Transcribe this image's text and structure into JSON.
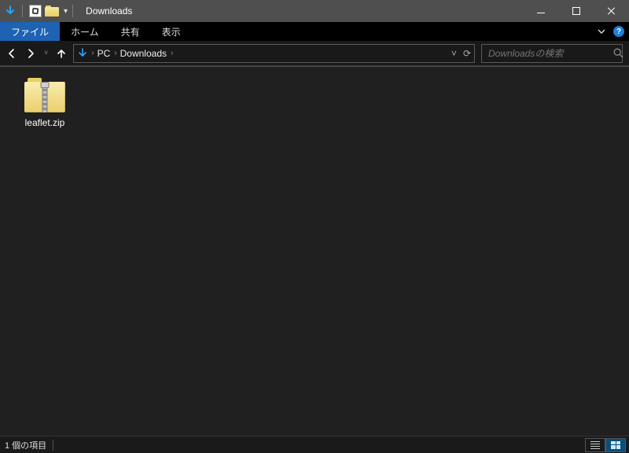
{
  "window": {
    "title": "Downloads"
  },
  "ribbon": {
    "file": "ファイル",
    "home": "ホーム",
    "share": "共有",
    "view": "表示"
  },
  "breadcrumb": {
    "root": "PC",
    "folder": "Downloads"
  },
  "search": {
    "placeholder": "Downloadsの検索"
  },
  "files": {
    "item0": {
      "name": "leaflet.zip"
    }
  },
  "status": {
    "count_label": "1 個の項目"
  }
}
